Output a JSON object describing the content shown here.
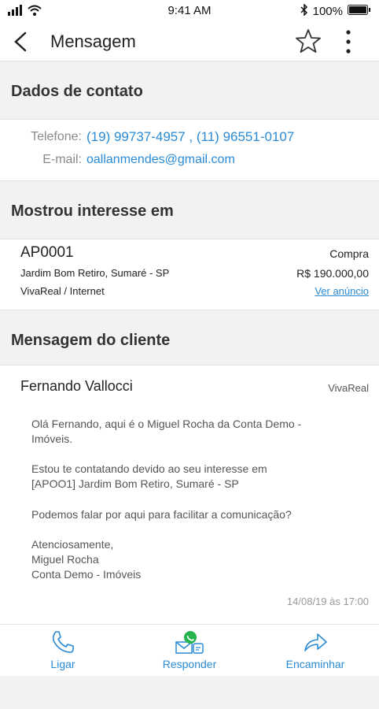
{
  "status_bar": {
    "time": "9:41 AM",
    "battery": "100%"
  },
  "header": {
    "title": "Mensagem"
  },
  "contact": {
    "section_title": "Dados de contato",
    "phone_label": "Telefone:",
    "phone_value": "(19) 99737-4957 , (11) 96551-0107",
    "email_label": "E-mail:",
    "email_value": "oallanmendes@gmail.com"
  },
  "interest": {
    "section_title": "Mostrou interesse em",
    "code": "AP0001",
    "type": "Compra",
    "address": "Jardim Bom Retiro, Sumaré - SP",
    "price": "R$ 190.000,00",
    "source": "VivaReal / Internet",
    "link": "Ver anúncio"
  },
  "message": {
    "section_title": "Mensagem do cliente",
    "sender": "Fernando Vallocci",
    "portal": "VivaReal",
    "paragraphs": [
      "Olá Fernando, aqui é o Miguel Rocha da Conta Demo -\nImóveis.",
      "Estou te contatando devido ao seu interesse em\n[APOO1] Jardim Bom Retiro, Sumaré - SP",
      "Podemos falar por aqui para facilitar a comunicação?",
      "Atenciosamente,\nMiguel Rocha\nConta Demo - Imóveis"
    ],
    "date": "14/08/19 às 17:00"
  },
  "actions": {
    "call": "Ligar",
    "reply": "Responder",
    "forward": "Encaminhar"
  },
  "colors": {
    "accent": "#2a8ad4",
    "whatsapp": "#25b34b"
  }
}
